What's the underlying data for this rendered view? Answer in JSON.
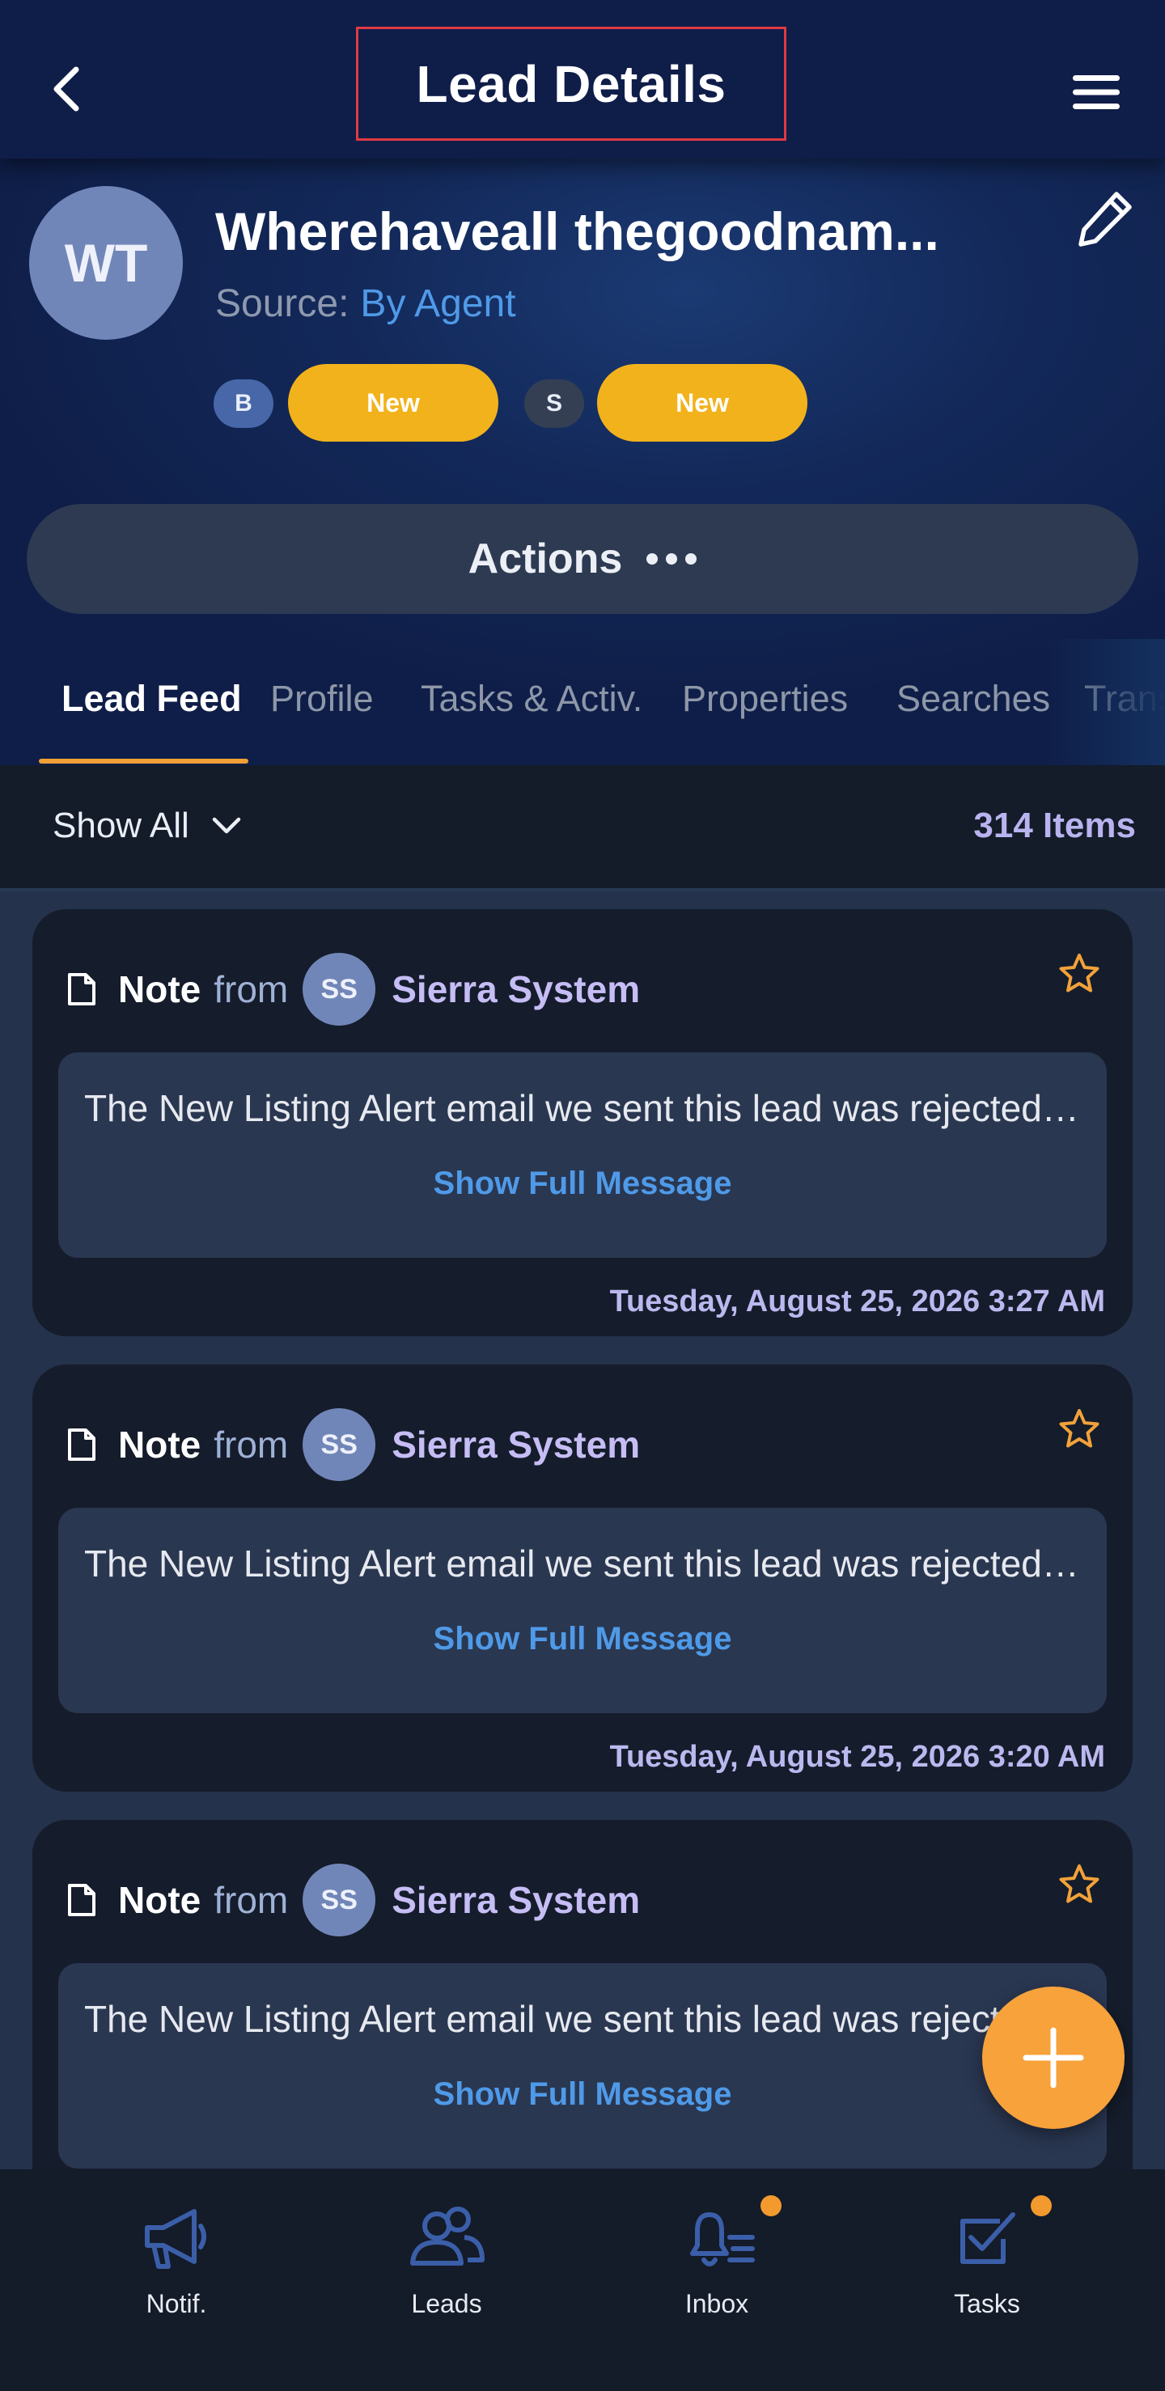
{
  "header": {
    "title": "Lead Details"
  },
  "lead": {
    "initials": "WT",
    "name": "Wherehaveall thegoodnam...",
    "source_label": "Source:",
    "source_value": "By Agent",
    "stages": [
      {
        "code": "B",
        "status": "New"
      },
      {
        "code": "S",
        "status": "New"
      }
    ]
  },
  "actions": {
    "label": "Actions"
  },
  "tabs": [
    {
      "label": "Lead Feed",
      "active": true
    },
    {
      "label": "Profile"
    },
    {
      "label": "Tasks & Activ."
    },
    {
      "label": "Properties"
    },
    {
      "label": "Searches"
    },
    {
      "label": "Trans"
    }
  ],
  "filter": {
    "label": "Show All",
    "count": "314 Items"
  },
  "feed": [
    {
      "type": "Note",
      "from": "from",
      "sender_initials": "SS",
      "sender": "Sierra System",
      "message": "The New Listing Alert email we sent this lead was rejected. T…",
      "show_full": "Show Full Message",
      "timestamp": "Tuesday, August 25, 2026 3:27 AM"
    },
    {
      "type": "Note",
      "from": "from",
      "sender_initials": "SS",
      "sender": "Sierra System",
      "message": "The New Listing Alert email we sent this lead was rejected. T…",
      "show_full": "Show Full Message",
      "timestamp": "Tuesday, August 25, 2026 3:20 AM"
    },
    {
      "type": "Note",
      "from": "from",
      "sender_initials": "SS",
      "sender": "Sierra System",
      "message": "The New Listing Alert email we sent this lead was rejected",
      "show_full": "Show Full Message",
      "timestamp": ""
    }
  ],
  "nav": [
    {
      "label": "Notif.",
      "icon": "megaphone-icon"
    },
    {
      "label": "Leads",
      "icon": "users-icon"
    },
    {
      "label": "Inbox",
      "icon": "bell-icon",
      "badge": true
    },
    {
      "label": "Tasks",
      "icon": "task-check-icon",
      "badge": true
    }
  ],
  "colors": {
    "accent_orange": "#f7a23a",
    "pill_yellow": "#f2b21b",
    "link_blue": "#4f9ae8",
    "sender_purple": "#c6bdf5",
    "header_navy": "#0f1d49"
  }
}
